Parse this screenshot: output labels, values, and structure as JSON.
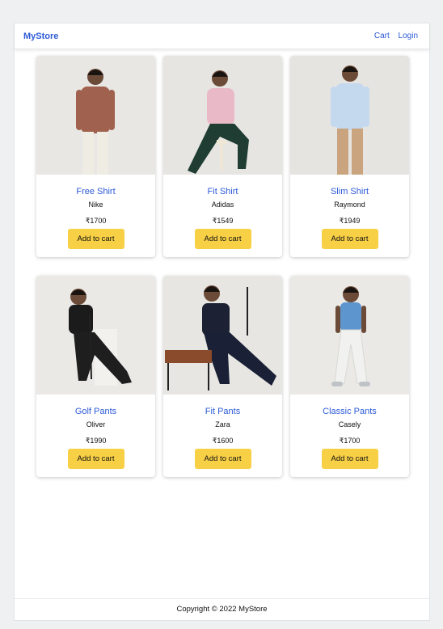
{
  "navbar": {
    "brand": "MyStore",
    "links": [
      "Cart",
      "Login"
    ]
  },
  "products": [
    {
      "name": "Free Shirt",
      "brand": "Nike",
      "price": "₹1700",
      "button": "Add to cart",
      "shirt_color": "#a0624e",
      "pants_color": "#efece4",
      "bg_color": "#e9e7e4"
    },
    {
      "name": "Fit Shirt",
      "brand": "Adidas",
      "price": "₹1549",
      "button": "Add to cart",
      "shirt_color": "#e9b9c8",
      "pants_color": "#1f3d33",
      "bg_color": "#e7e5e2"
    },
    {
      "name": "Slim Shirt",
      "brand": "Raymond",
      "price": "₹1949",
      "button": "Add to cart",
      "shirt_color": "#c5d9ee",
      "pants_color": "#c9a47f",
      "bg_color": "#e6e4e1"
    },
    {
      "name": "Golf Pants",
      "brand": "Oliver",
      "price": "₹1990",
      "button": "Add to cart",
      "shirt_color": "#1b1b1b",
      "pants_color": "#1e1e1e",
      "bg_color": "#ebe9e6"
    },
    {
      "name": "Fit Pants",
      "brand": "Zara",
      "price": "₹1600",
      "button": "Add to cart",
      "shirt_color": "#1c2233",
      "pants_color": "#1a2035",
      "bg_color": "#e8e6e3"
    },
    {
      "name": "Classic Pants",
      "brand": "Casely",
      "price": "₹1700",
      "button": "Add to cart",
      "shirt_color": "#5d95cf",
      "pants_color": "#f1f1ef",
      "bg_color": "#ebe9e6"
    }
  ],
  "footer": {
    "copyright": "Copyright © 2022 MyStore"
  }
}
